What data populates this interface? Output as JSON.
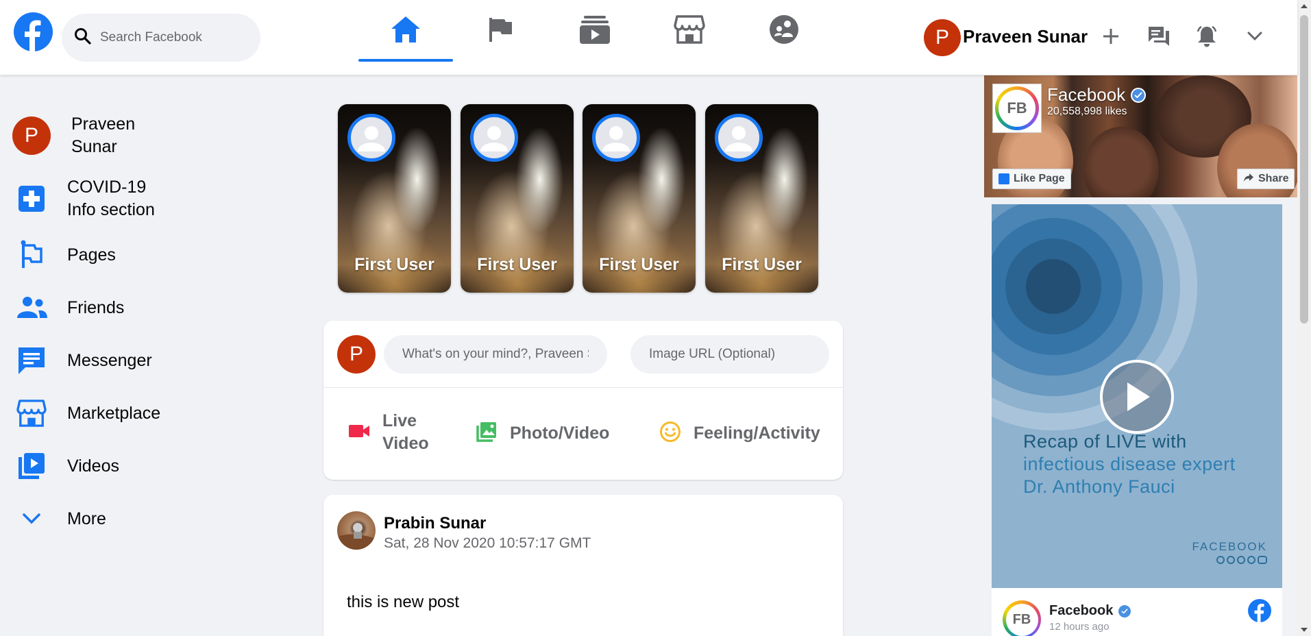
{
  "header": {
    "search_placeholder": "Search Facebook",
    "nav_tabs": [
      {
        "name": "home-icon",
        "active": true
      },
      {
        "name": "pages-flag-icon",
        "active": false
      },
      {
        "name": "watch-icon",
        "active": false
      },
      {
        "name": "marketplace-icon",
        "active": false
      },
      {
        "name": "groups-icon",
        "active": false
      }
    ],
    "avatar_initial": "P",
    "user_name": "Praveen Sunar"
  },
  "sidebar": {
    "items": [
      {
        "label": "Praveen Sunar",
        "icon": "avatar",
        "initial": "P"
      },
      {
        "label": "COVID-19 Info section",
        "icon": "covid-plus-icon"
      },
      {
        "label": "Pages",
        "icon": "pages-flag-icon"
      },
      {
        "label": "Friends",
        "icon": "friends-icon"
      },
      {
        "label": "Messenger",
        "icon": "messenger-icon"
      },
      {
        "label": "Marketplace",
        "icon": "marketplace-icon"
      },
      {
        "label": "Videos",
        "icon": "videos-icon"
      },
      {
        "label": "More",
        "icon": "chevron-down-icon"
      }
    ]
  },
  "stories": [
    {
      "name": "First User"
    },
    {
      "name": "First User"
    },
    {
      "name": "First User"
    },
    {
      "name": "First User"
    }
  ],
  "composer": {
    "avatar_initial": "P",
    "message_placeholder": "What's on your mind?, Praveen Sunar",
    "image_placeholder": "Image URL (Optional)",
    "actions": [
      {
        "label": "Live Video",
        "icon": "live-video-icon",
        "color": "#f02849"
      },
      {
        "label": "Photo/Video",
        "icon": "photo-icon",
        "color": "#45bd62"
      },
      {
        "label": "Feeling/Activity",
        "icon": "smile-icon",
        "color": "#f7b928"
      }
    ]
  },
  "post": {
    "author": "Prabin Sunar",
    "timestamp": "Sat, 28 Nov 2020 10:57:17 GMT",
    "text": "this is new post"
  },
  "page_widget": {
    "page_name": "Facebook",
    "likes": "20,558,998 likes",
    "logo_text": "FB",
    "like_button": "Like Page",
    "share_button": "Share",
    "video_line1": "Recap of LIVE with",
    "video_line2": "infectious disease expert",
    "video_line3": "Dr. Anthony Fauci",
    "brand": "FACEBOOK",
    "post_name": "Facebook",
    "post_time": "12 hours ago"
  },
  "colors": {
    "accent": "#1877f2",
    "avatar_bg": "#c4320a",
    "page_bg": "#f0f2f5"
  }
}
